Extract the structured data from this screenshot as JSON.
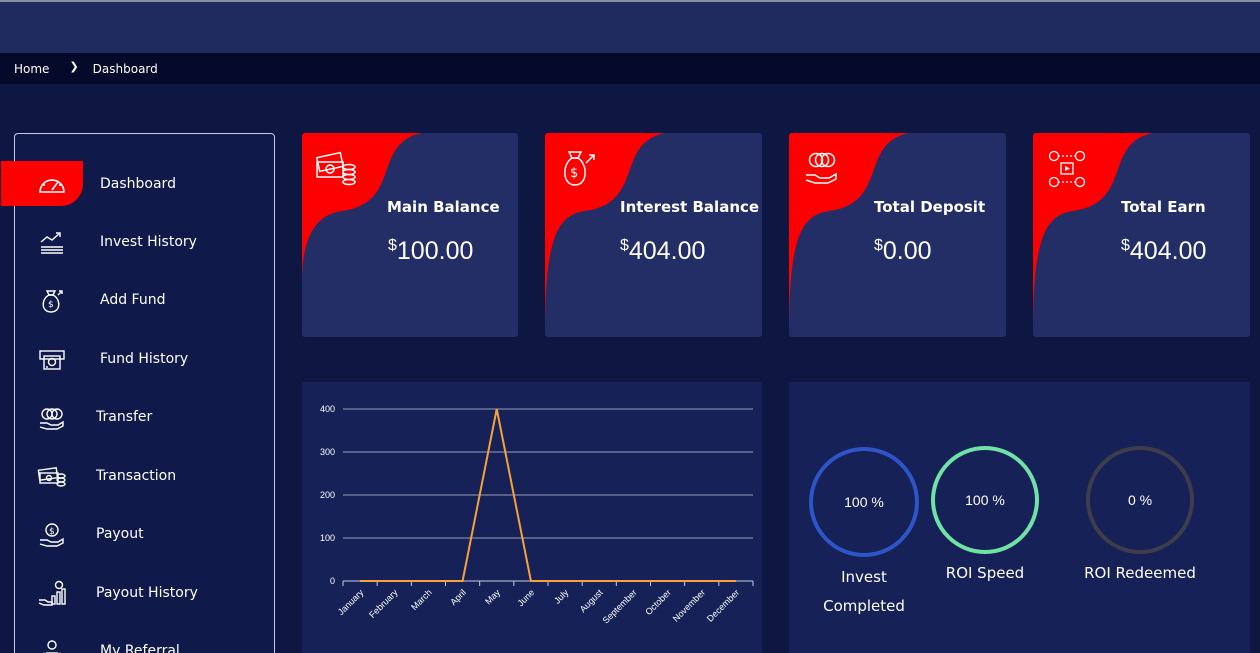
{
  "breadcrumb": {
    "home": "Home",
    "current": "Dashboard"
  },
  "sidebar": {
    "items": [
      {
        "label": "Dashboard",
        "icon": "speedometer-icon",
        "active": true
      },
      {
        "label": "Invest History",
        "icon": "growth-chart-icon"
      },
      {
        "label": "Add Fund",
        "icon": "money-bag-icon"
      },
      {
        "label": "Fund History",
        "icon": "cash-machine-icon"
      },
      {
        "label": "Transfer",
        "icon": "coins-hand-icon"
      },
      {
        "label": "Transaction",
        "icon": "cash-coins-icon"
      },
      {
        "label": "Payout",
        "icon": "hand-coin-icon"
      },
      {
        "label": "Payout History",
        "icon": "payout-chart-icon"
      },
      {
        "label": "My Referral",
        "icon": "users-icon"
      }
    ]
  },
  "cards": [
    {
      "title": "Main Balance",
      "currency": "$",
      "amount": "100.00",
      "icon": "cash-coins-icon"
    },
    {
      "title": "Interest Balance",
      "currency": "$",
      "amount": "404.00",
      "icon": "money-bag-icon"
    },
    {
      "title": "Total Deposit",
      "currency": "$",
      "amount": "0.00",
      "icon": "coins-hand-icon"
    },
    {
      "title": "Total Earn",
      "currency": "$",
      "amount": "404.00",
      "icon": "earnings-network-icon"
    }
  ],
  "stats": [
    {
      "value": "100 %",
      "label_line1": "Invest",
      "label_line2": "Completed",
      "color": "#2d55c8"
    },
    {
      "value": "100 %",
      "label_line1": "ROI Speed",
      "label_line2": "",
      "color": "#6fe3a6"
    },
    {
      "value": "0 %",
      "label_line1": "ROI Redeemed",
      "label_line2": "",
      "color": "#3f3c4c"
    }
  ],
  "colors": {
    "accent": "#ff0000",
    "card_bg": "#232d66",
    "panel_bg": "#162157",
    "line": "#f5a23c"
  },
  "chart_data": {
    "type": "line",
    "categories": [
      "January",
      "February",
      "March",
      "April",
      "May",
      "June",
      "July",
      "August",
      "September",
      "October",
      "November",
      "December"
    ],
    "series": [
      {
        "values": [
          0,
          0,
          0,
          0,
          400,
          0,
          0,
          0,
          0,
          0,
          0,
          0
        ]
      }
    ],
    "yticks": [
      "0",
      "100",
      "200",
      "300",
      "400"
    ],
    "ylim": [
      0,
      400
    ],
    "grid": true,
    "legend": "none"
  }
}
